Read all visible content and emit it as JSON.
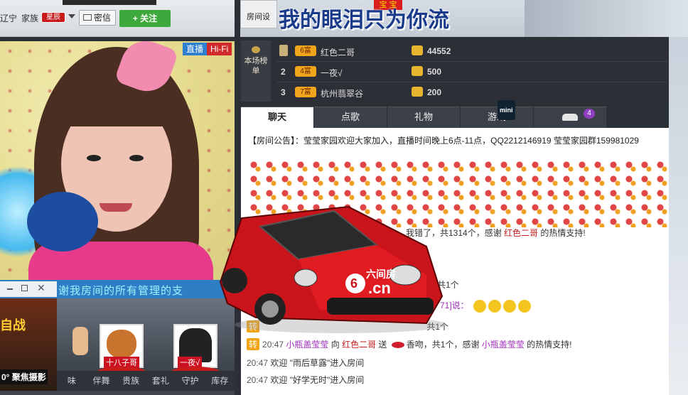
{
  "topbar": {
    "location": "辽宁",
    "clan_label": "家族",
    "clan_badge": "星辰",
    "message_label": "密信",
    "follow_label": "+ 关注"
  },
  "video": {
    "live_tag": "直播",
    "hifi_tag": "Hi-Fi"
  },
  "small_window": {
    "banner_text": "谢我房间的所有管理的支",
    "ad_line1": "自战",
    "ad_line2": "0° 聚焦摄影",
    "cards": [
      {
        "label": "十八子哥"
      },
      {
        "label": "一夜√"
      }
    ],
    "tabs": [
      "味",
      "伴舞",
      "贵族",
      "套礼",
      "守护",
      "库存"
    ]
  },
  "room": {
    "settings_label": "房间设",
    "sign_text": "我的眼泪只为你流",
    "sign_badge": "宝 宝"
  },
  "ranking": {
    "label": "本场榜单",
    "rows": [
      {
        "rank": "",
        "level": "6富",
        "name": "红色二哥",
        "value": "44552"
      },
      {
        "rank": "2",
        "level": "4富",
        "name": "一夜√",
        "value": "500"
      },
      {
        "rank": "3",
        "level": "7富",
        "name": "杭州翡翠谷",
        "value": "200"
      }
    ]
  },
  "tabs": {
    "items": [
      "聊天",
      "点歌",
      "礼物",
      "游戏",
      ""
    ],
    "mini_badge": "mini",
    "car_count": "4"
  },
  "chat": {
    "announcement": "【房间公告】：莹莹家园欢迎大家加入，直播时间晚上6点-11点，QQ2212146919 莹莹家园群159981029",
    "gift_line": {
      "text1": "我错了，共1314个，感谢 ",
      "user": "红色二哥",
      "text2": " 的热情支持!"
    },
    "partial_1": "共1个",
    "partial_2_prefix": "71]说：",
    "partial_3": "共1个",
    "gift2": {
      "tag": "转",
      "time": "20:47",
      "sender": "小瓶盖莹莹",
      "mid": " 向 ",
      "target": "红色二哥",
      "verb": " 送 ",
      "gift": "香吻，共1个，感谢 ",
      "thanks_user": "小瓶盖莹莹",
      "tail": " 的热情支持!"
    },
    "welcome1": {
      "time": "20:47",
      "text": "欢迎 \"雨后草露\"进入房间"
    },
    "welcome2": {
      "time": "20:47",
      "text": "欢迎 \"好学无时\"进入房间"
    }
  },
  "car": {
    "brand": "六间房",
    "domain": ".cn",
    "number": "6"
  }
}
